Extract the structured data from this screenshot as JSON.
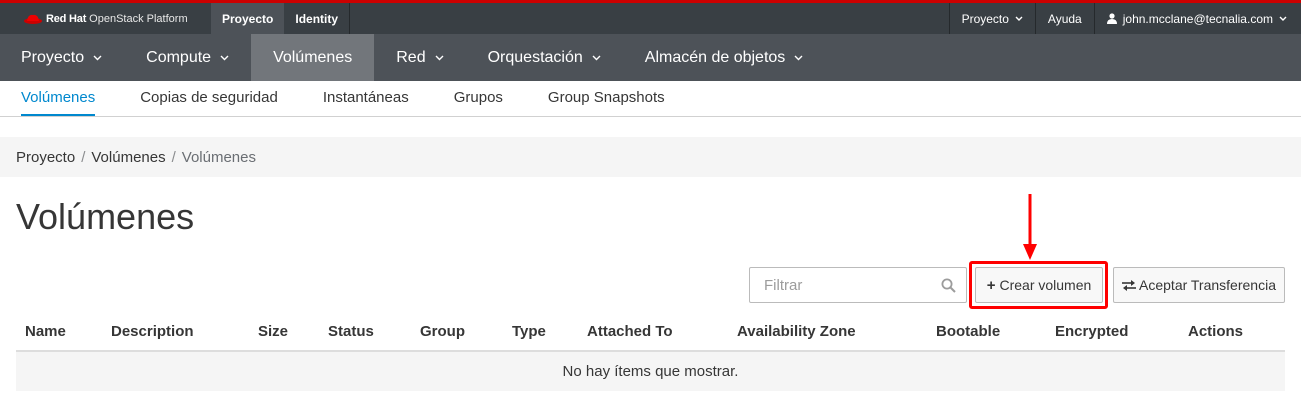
{
  "brand": {
    "name": "Red Hat",
    "product": "OpenStack Platform"
  },
  "top_tabs": [
    "Proyecto",
    "Identity"
  ],
  "top_right": {
    "project_menu": "Proyecto",
    "help": "Ayuda",
    "user": "john.mcclane@tecnalia.com"
  },
  "main_nav": [
    "Proyecto",
    "Compute",
    "Volúmenes",
    "Red",
    "Orquestación",
    "Almacén de objetos"
  ],
  "sub_nav": [
    "Volúmenes",
    "Copias de seguridad",
    "Instantáneas",
    "Grupos",
    "Group Snapshots"
  ],
  "breadcrumb": [
    "Proyecto",
    "Volúmenes",
    "Volúmenes"
  ],
  "page_title": "Volúmenes",
  "toolbar": {
    "filter_placeholder": "Filtrar",
    "create_label": "Crear volumen",
    "accept_label": "Aceptar Transferencia"
  },
  "table": {
    "columns": [
      "Name",
      "Description",
      "Size",
      "Status",
      "Group",
      "Type",
      "Attached To",
      "Availability Zone",
      "Bootable",
      "Encrypted",
      "Actions"
    ],
    "empty_message": "No hay ítems que mostrar."
  },
  "colors": {
    "accent": "#0088ce",
    "highlight": "#ff0000",
    "brand_red": "#cc0000"
  }
}
